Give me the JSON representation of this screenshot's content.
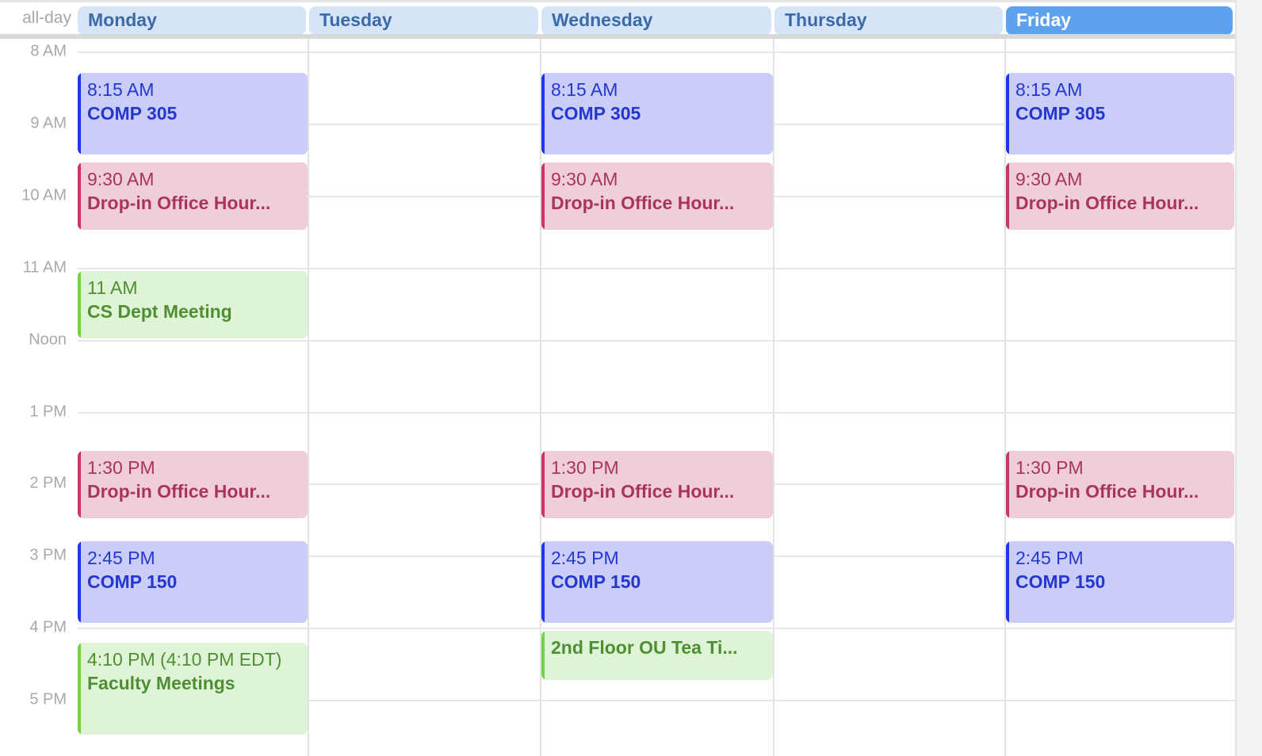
{
  "header": {
    "allday_label": "all-day",
    "days": [
      {
        "label": "Monday",
        "today": false
      },
      {
        "label": "Tuesday",
        "today": false
      },
      {
        "label": "Wednesday",
        "today": false
      },
      {
        "label": "Thursday",
        "today": false
      },
      {
        "label": "Friday",
        "today": true
      }
    ]
  },
  "hours": [
    "8 AM",
    "9 AM",
    "10 AM",
    "11 AM",
    "Noon",
    "1 PM",
    "2 PM",
    "3 PM",
    "4 PM",
    "5 PM"
  ],
  "colors": {
    "blue": "#1f36ef",
    "pink": "#cc3463",
    "green": "#72d24a",
    "today_header": "#5ea2ee",
    "day_header": "#d6e4f8"
  },
  "events": [
    {
      "day": 0,
      "start": 8.25,
      "end": 9.45,
      "color": "blue",
      "time": "8:15 AM",
      "title": "COMP 305"
    },
    {
      "day": 0,
      "start": 9.5,
      "end": 10.5,
      "color": "pink",
      "time": "9:30 AM",
      "title": "Drop-in Office Hour..."
    },
    {
      "day": 0,
      "start": 11.0,
      "end": 12.0,
      "color": "green",
      "time": "11 AM",
      "title": "CS Dept Meeting"
    },
    {
      "day": 0,
      "start": 13.5,
      "end": 14.5,
      "color": "pink",
      "time": "1:30 PM",
      "title": "Drop-in Office Hour..."
    },
    {
      "day": 0,
      "start": 14.75,
      "end": 15.95,
      "color": "blue",
      "time": "2:45 PM",
      "title": "COMP 150"
    },
    {
      "day": 0,
      "start": 16.167,
      "end": 17.5,
      "color": "green",
      "time": "4:10 PM (4:10 PM EDT)",
      "title": "Faculty Meetings"
    },
    {
      "day": 2,
      "start": 8.25,
      "end": 9.45,
      "color": "blue",
      "time": "8:15 AM",
      "title": "COMP 305"
    },
    {
      "day": 2,
      "start": 9.5,
      "end": 10.5,
      "color": "pink",
      "time": "9:30 AM",
      "title": "Drop-in Office Hour..."
    },
    {
      "day": 2,
      "start": 13.5,
      "end": 14.5,
      "color": "pink",
      "time": "1:30 PM",
      "title": "Drop-in Office Hour..."
    },
    {
      "day": 2,
      "start": 14.75,
      "end": 15.95,
      "color": "blue",
      "time": "2:45 PM",
      "title": "COMP 150"
    },
    {
      "day": 2,
      "start": 16.0,
      "end": 16.75,
      "color": "green",
      "time": "",
      "title": "2nd Floor OU Tea Ti..."
    },
    {
      "day": 4,
      "start": 8.25,
      "end": 9.45,
      "color": "blue",
      "time": "8:15 AM",
      "title": "COMP 305"
    },
    {
      "day": 4,
      "start": 9.5,
      "end": 10.5,
      "color": "pink",
      "time": "9:30 AM",
      "title": "Drop-in Office Hour..."
    },
    {
      "day": 4,
      "start": 13.5,
      "end": 14.5,
      "color": "pink",
      "time": "1:30 PM",
      "title": "Drop-in Office Hour..."
    },
    {
      "day": 4,
      "start": 14.75,
      "end": 15.95,
      "color": "blue",
      "time": "2:45 PM",
      "title": "COMP 150"
    }
  ]
}
